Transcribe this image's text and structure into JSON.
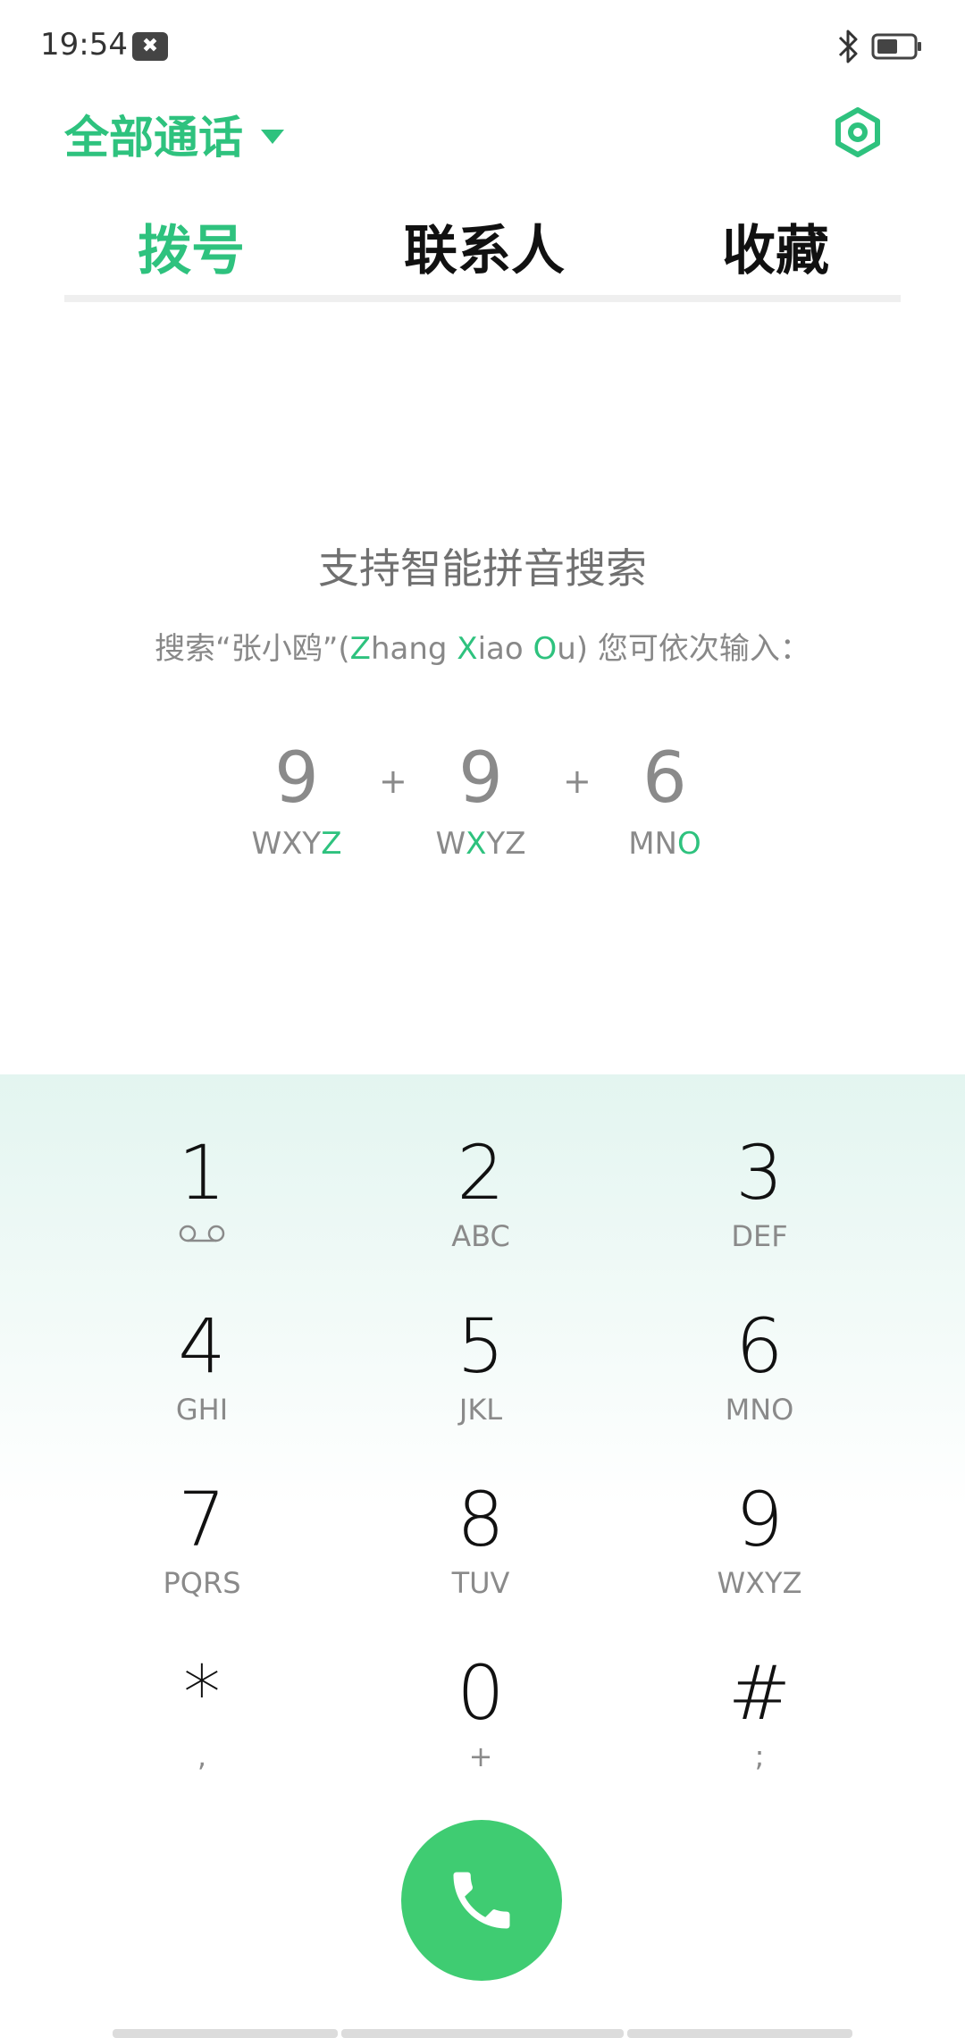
{
  "status_bar": {
    "time": "19:54",
    "notification_glyph": "✖",
    "icons": [
      "notification-icon",
      "bluetooth-icon",
      "battery-icon"
    ]
  },
  "header": {
    "filter_label": "全部通话",
    "icons": [
      "caret-down-icon",
      "settings-icon"
    ],
    "accent_color": "#2ec27e"
  },
  "tabs": [
    {
      "label": "拨号",
      "active": true
    },
    {
      "label": "联系人",
      "active": false
    },
    {
      "label": "收藏",
      "active": false
    }
  ],
  "hint": {
    "title": "支持智能拼音搜索",
    "sub_prefix": "搜索“张小鸥”(",
    "z": "Z",
    "hang": "hang ",
    "x": "X",
    "iao": "iao ",
    "o": "O",
    "u": "u",
    "sub_suffix": ") 您可依次输入：",
    "example": [
      {
        "digit": "9",
        "letters_plain": "WXY",
        "letters_hl": "Z",
        "letters_after": ""
      },
      {
        "digit": "9",
        "letters_plain": "W",
        "letters_hl": "X",
        "letters_after": "YZ"
      },
      {
        "digit": "6",
        "letters_plain": "MN",
        "letters_hl": "O",
        "letters_after": ""
      }
    ],
    "plus": "+"
  },
  "keypad": {
    "keys": [
      {
        "digit": "1",
        "letters": ""
      },
      {
        "digit": "2",
        "letters": "ABC"
      },
      {
        "digit": "3",
        "letters": "DEF"
      },
      {
        "digit": "4",
        "letters": "GHI"
      },
      {
        "digit": "5",
        "letters": "JKL"
      },
      {
        "digit": "6",
        "letters": "MNO"
      },
      {
        "digit": "7",
        "letters": "PQRS"
      },
      {
        "digit": "8",
        "letters": "TUV"
      },
      {
        "digit": "9",
        "letters": "WXYZ"
      },
      {
        "digit": "*",
        "letters": ","
      },
      {
        "digit": "0",
        "letters": "+"
      },
      {
        "digit": "#",
        "letters": ";"
      }
    ],
    "icons": [
      "voicemail-icon",
      "phone-icon"
    ],
    "call_color": "#3fcc72"
  }
}
